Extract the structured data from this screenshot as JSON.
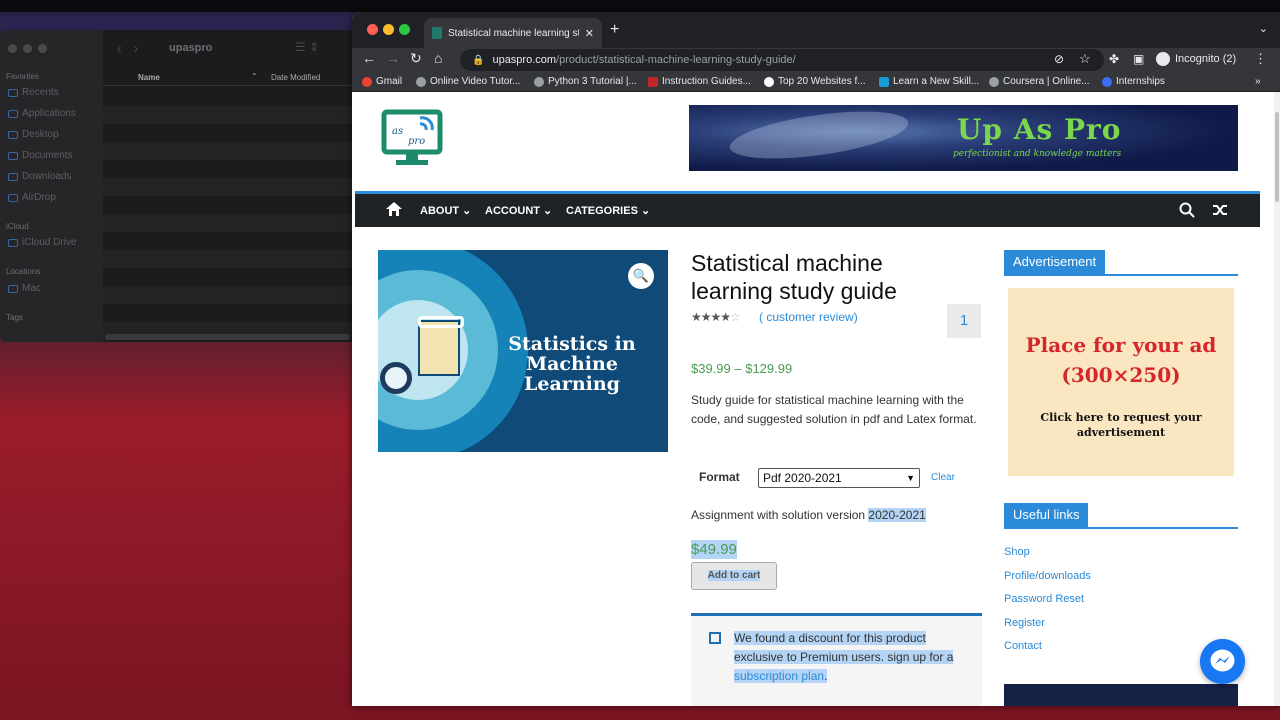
{
  "finder": {
    "title": "upaspro",
    "sections": {
      "favorites": "Favorites",
      "icloud": "iCloud",
      "locations": "Locations",
      "tags": "Tags"
    },
    "sidebar_items": [
      "Recents",
      "Applications",
      "Desktop",
      "Documents",
      "Downloads",
      "AirDrop"
    ],
    "icloud_items": [
      "iCloud Drive"
    ],
    "location_items": [
      "Mac"
    ],
    "columns": {
      "name": "Name",
      "date": "Date Modified"
    }
  },
  "browser": {
    "tab_title": "Statistical machine learning stu",
    "url_host": "upaspro.com",
    "url_path": "/product/statistical-machine-learning-study-guide/",
    "profile": "Incognito (2)",
    "bookmarks": [
      "Gmail",
      "Online Video Tutor...",
      "Python 3 Tutorial |...",
      "Instruction Guides...",
      "Top 20 Websites f...",
      "Learn a New Skill...",
      "Coursera | Online...",
      "Internships"
    ]
  },
  "site": {
    "logo_text": "as pro",
    "banner_title": "Up As Pro",
    "banner_subtitle": "perfectionist and knowledge matters",
    "nav": [
      "ABOUT",
      "ACCOUNT",
      "CATEGORIES"
    ]
  },
  "product": {
    "image_text": "Statistics in Machine Learning",
    "title": "Statistical machine learning study guide",
    "rating": 4,
    "review_link": "( customer review)",
    "review_count": "1",
    "price_range": "$39.99 – $129.99",
    "description": "Study guide for statistical machine learning with the code, and suggested solution in pdf and Latex format.",
    "format_label": "Format",
    "format_selected": "Pdf 2020-2021",
    "clear_label": "Clear",
    "variation_text": "Assignment with solution version ",
    "variation_version": "2020-2021",
    "variation_price": "$49.99",
    "add_to_cart": "Add to cart",
    "discount_text": "We found a discount for this product exclusive to Premium users. sign up for a ",
    "discount_link": "subscription plan",
    "discount_end": "."
  },
  "sidebar": {
    "ad_title": "Advertisement",
    "ad_line1": "Place for your ad (300×250)",
    "ad_line2": "Click here to request your advertisement",
    "links_title": "Useful links",
    "links": [
      "Shop",
      "Profile/downloads",
      "Password Reset",
      "Register",
      "Contact"
    ]
  },
  "colors": {
    "accent": "#2b8bd8",
    "price": "#4a9c55",
    "nav_bg": "#1f2326",
    "ad_red": "#d4262c"
  }
}
